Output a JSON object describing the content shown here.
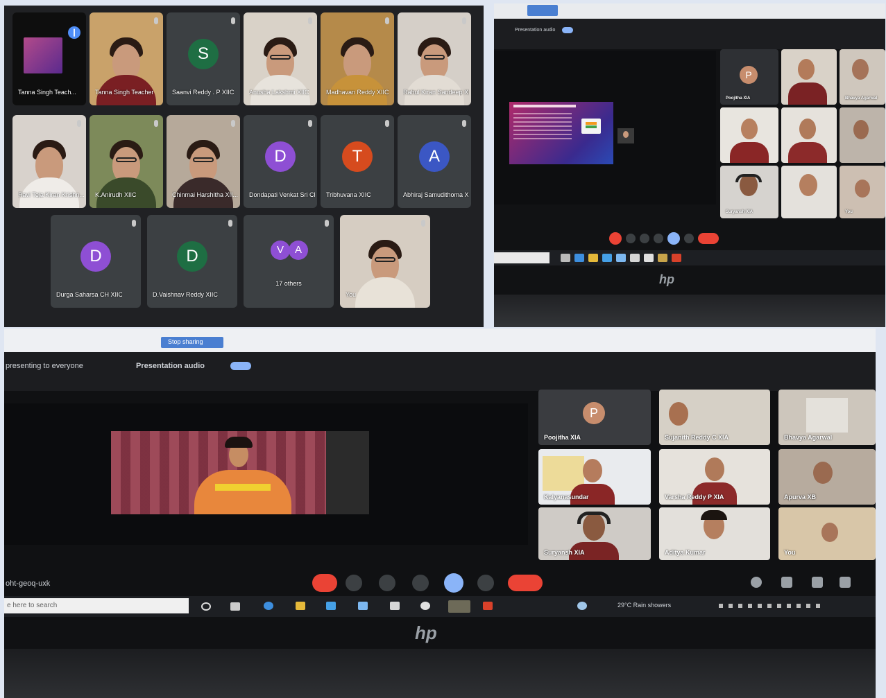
{
  "collage": {
    "top_left": {
      "tiles": [
        {
          "name": "Tanna Singh Teach...",
          "kind": "screen",
          "pinned": true
        },
        {
          "name": "Tanna Singh Teacher",
          "kind": "camera"
        },
        {
          "name": "Saanvi Reddy . P XIIC",
          "kind": "avatar",
          "initial": "S",
          "color": "#1e6e43"
        },
        {
          "name": "Anusha Lakshmi XIIC",
          "kind": "camera"
        },
        {
          "name": "Madhavan Reddy XIIC",
          "kind": "camera"
        },
        {
          "name": "Rahul Kiran Sandeep XIIC",
          "kind": "camera"
        },
        {
          "name": "Ravi Teja Kiran Krishn...",
          "kind": "camera"
        },
        {
          "name": "K.Anirudh XIIC",
          "kind": "camera"
        },
        {
          "name": "Chinmai Harshitha XII...",
          "kind": "camera"
        },
        {
          "name": "Dondapati Venkat Sri Ch...",
          "kind": "avatar",
          "initial": "D",
          "color": "#8e4fd4"
        },
        {
          "name": "Tribhuvana XIIC",
          "kind": "avatar",
          "initial": "T",
          "color": "#d64b1e"
        },
        {
          "name": "Abhiraj Samudithoma XIIC",
          "kind": "avatar",
          "initial": "A",
          "color": "#3b57c4"
        },
        {
          "name": "Durga Saharsa CH XIIC",
          "kind": "avatar",
          "initial": "D",
          "color": "#8e4fd4"
        },
        {
          "name": "D.Vaishnav Reddy XIIC",
          "kind": "avatar",
          "initial": "D",
          "color": "#1e6e43"
        },
        {
          "name": "17 others",
          "kind": "others",
          "initials": [
            "V",
            "A"
          ]
        },
        {
          "name": "You",
          "kind": "camera"
        }
      ]
    },
    "top_right": {
      "toolbar_text": "Presentation audio",
      "tiles": [
        "Poojitha XIA",
        "",
        "Bhavya Agarwal",
        "",
        "",
        "",
        "Suryansh XIA",
        "",
        "You"
      ],
      "avatar_initial": "P"
    },
    "bottom": {
      "browser_tab": "Stop sharing",
      "presenting_text": "presenting to everyone",
      "presentation_audio": "Presentation audio",
      "meeting_code": "oht-geoq-uxk",
      "search_placeholder": "e here to search",
      "weather": "29°C  Rain showers",
      "brand": "hp",
      "tiles": [
        {
          "name": "Poojitha XIA",
          "kind": "avatar",
          "initial": "P"
        },
        {
          "name": "Sujanith Reddy C XIA",
          "kind": "camera"
        },
        {
          "name": "Bhavya Agarwal",
          "kind": "camera"
        },
        {
          "name": "Kalyanasundar",
          "kind": "camera"
        },
        {
          "name": "Varsha Reddy P XIA",
          "kind": "camera"
        },
        {
          "name": "Apurva XB",
          "kind": "camera"
        },
        {
          "name": "Suryansh XIA",
          "kind": "camera"
        },
        {
          "name": "Aditya Kumar",
          "kind": "camera"
        },
        {
          "name": "You",
          "kind": "camera"
        }
      ]
    }
  }
}
